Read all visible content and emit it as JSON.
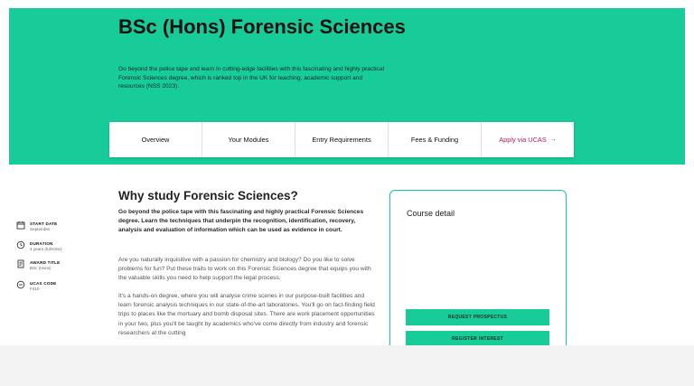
{
  "hero": {
    "title": "BSc (Hons) Forensic Sciences",
    "description": "Go beyond the police tape and learn in cutting-edge facilities with this fascinating and highly practical Forensic Sciences degree, which is ranked top in the UK for teaching, academic support and resources (NSS 2023)."
  },
  "tabs": [
    {
      "label": "Overview"
    },
    {
      "label": "Your Modules"
    },
    {
      "label": "Entry Requirements"
    },
    {
      "label": "Fees & Funding"
    },
    {
      "label": "Apply via UCAS"
    }
  ],
  "main": {
    "heading": "Why study Forensic Sciences?",
    "lead": "Go beyond the police tape with this fascinating and highly practical Forensic Sciences degree. Learn the techniques that underpin the recognition, identification, recovery, analysis and evaluation of information which can be used as evidence in court.",
    "para1": "Are you naturally inquisitive with a passion for chemistry and biology? Do you like to solve problems for fun? Put these traits to work on this Forensic Sciences degree that equips you with the valuable skills you need to help support the legal process.",
    "para2": "It's a hands-on degree, where you will analyse crime scenes in our purpose-built facilities and learn forensic analysis techniques in our state-of-the-art laboratories. You'll go on fact-finding field trips to places like the mortuary and bomb disposal sites. There are work placement opportunities in your two, plus you'll be taught by academics who've come directly from industry and forensic researchers at the cutting"
  },
  "course_detail": {
    "title": "Course detail",
    "items": [
      {
        "label": "START DATE",
        "value": "September",
        "icon": "calendar-icon"
      },
      {
        "label": "DURATION",
        "value": "4 years (full-time)",
        "icon": "clock-icon"
      },
      {
        "label": "AWARD TITLE",
        "value": "BSc (Hons)",
        "icon": "award-icon"
      },
      {
        "label": "UCAS CODE",
        "value": "F410",
        "icon": "ucas-code-icon"
      }
    ],
    "buttons": {
      "prospectus": "REQUEST PROSPECTUS",
      "register": "REGISTER INTEREST"
    }
  },
  "colors": {
    "accent": "#17cc98",
    "link": "#c2185b"
  }
}
